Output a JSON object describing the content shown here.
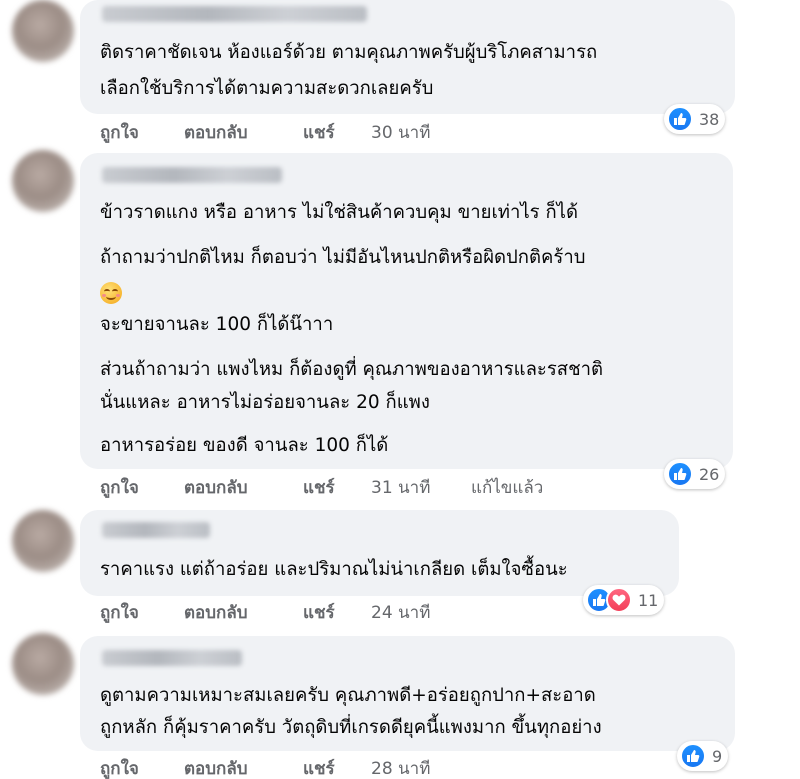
{
  "comments": [
    {
      "lines": [
        "ติดราคาชัดเจน ห้องแอร์ด้วย ตามคุณภาพครับผู้บริโภคสามารถ",
        "เลือกใช้บริการได้ตามความสะดวกเลยครับ"
      ],
      "actions": {
        "like": "ถูกใจ",
        "reply": "ตอบกลับ",
        "share": "แชร์",
        "time": "30 นาที"
      },
      "reactions": {
        "count": "38",
        "types": [
          "like"
        ]
      }
    },
    {
      "lines": [
        "ข้าวราดแกง หรือ อาหาร ไม่ใช่สินค้าควบคุม ขายเท่าไร ก็ได้",
        "ถ้าถามว่าปกติไหม ก็ตอบว่า ไม่มีอันไหนปกติหรือผิดปกติคร้าบ",
        "จะขายจานละ 100 ก็ได้น๊าาา",
        "ส่วนถ้าถามว่า แพงไหม ก็ต้องดูที่ คุณภาพของอาหารและรสชาติ",
        "นั่นแหละ อาหารไม่อร่อยจานละ 20 ก็แพง",
        "อาหารอร่อย ของดี จานละ 100 ก็ได้"
      ],
      "emoji": "smiling-face-emoji",
      "actions": {
        "like": "ถูกใจ",
        "reply": "ตอบกลับ",
        "share": "แชร์",
        "time": "31 นาที",
        "edited": "แก้ไขแล้ว"
      },
      "reactions": {
        "count": "26",
        "types": [
          "like"
        ]
      }
    },
    {
      "lines": [
        "ราคาแรง แต่ถ้าอร่อย และปริมาณไม่น่าเกลียด เต็มใจซื้อนะ"
      ],
      "actions": {
        "like": "ถูกใจ",
        "reply": "ตอบกลับ",
        "share": "แชร์",
        "time": "24 นาที"
      },
      "reactions": {
        "count": "11",
        "types": [
          "like",
          "love"
        ]
      }
    },
    {
      "lines": [
        "ดูตามความเหมาะสมเลยครับ คุณภาพดี+อร่อยถูกปาก+สะอาด",
        "ถูกหลัก ก็คุ้มราคาครับ วัตถุดิบที่เกรดดียุคนี้แพงมาก ขึ้นทุกอย่าง"
      ],
      "actions": {
        "like": "ถูกใจ",
        "reply": "ตอบกลับ",
        "share": "แชร์",
        "time": "28 นาที"
      },
      "reactions": {
        "count": "9",
        "types": [
          "like"
        ]
      }
    }
  ],
  "colors": {
    "like": "#1877f2",
    "love": "#f33e58",
    "bubble": "#f0f2f5",
    "meta": "#65676b"
  }
}
